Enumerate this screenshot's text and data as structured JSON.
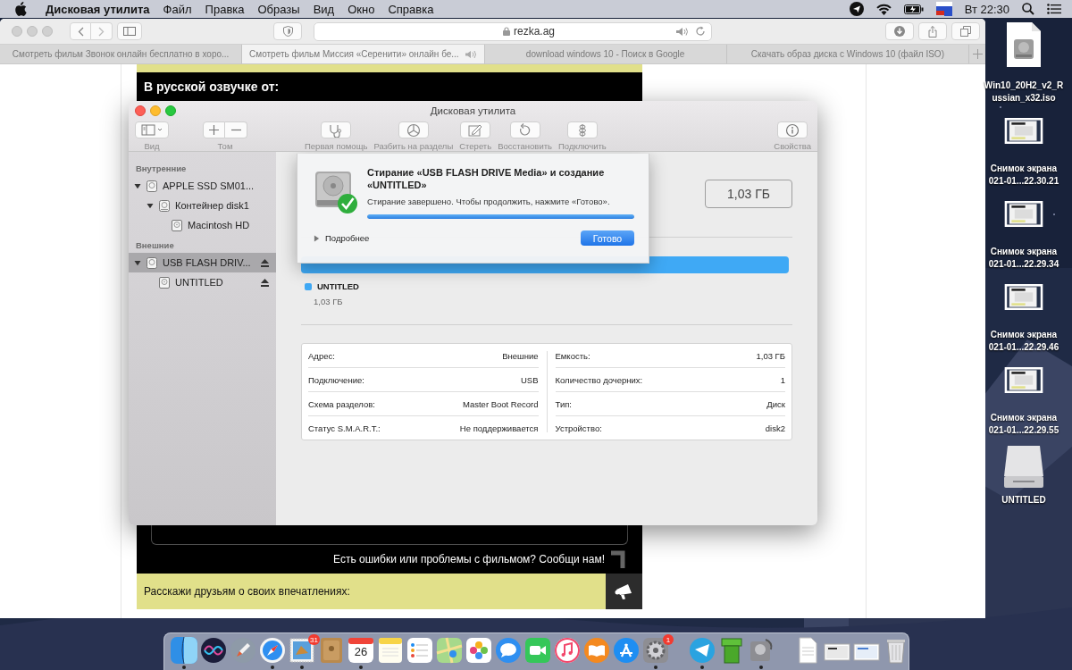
{
  "menubar": {
    "app_name": "Дисковая утилита",
    "menus": [
      "Файл",
      "Правка",
      "Образы",
      "Вид",
      "Окно",
      "Справка"
    ],
    "clock": "Вт 22:30"
  },
  "browser": {
    "url": "rezka.ag",
    "tabs": [
      {
        "label": "Смотреть фильм Звонок онлайн бесплатно в хоро...",
        "selected": false,
        "audio": false
      },
      {
        "label": "Смотреть фильм Миссия «Серенити» онлайн бе...",
        "selected": true,
        "audio": true
      },
      {
        "label": "download windows 10 - Поиск в Google",
        "selected": false,
        "audio": false
      },
      {
        "label": "Скачать образ диска с Windows 10 (файл ISO)",
        "selected": false,
        "audio": false
      }
    ],
    "page": {
      "heading": "В русской озвучке от:",
      "report_text": "Есть ошибки или проблемы с фильмом? Сообщи нам!",
      "share_text": "Расскажи друзьям о своих впечатлениях:"
    }
  },
  "disk_utility": {
    "title": "Дисковая утилита",
    "toolbar": [
      {
        "label": "Вид",
        "kind": "view"
      },
      {
        "label": "Том",
        "kind": "volume"
      },
      {
        "label": "Первая помощь",
        "kind": "first-aid"
      },
      {
        "label": "Разбить на разделы",
        "kind": "partition"
      },
      {
        "label": "Стереть",
        "kind": "erase"
      },
      {
        "label": "Восстановить",
        "kind": "restore"
      },
      {
        "label": "Подключить",
        "kind": "mount"
      },
      {
        "label": "Свойства",
        "kind": "info"
      }
    ],
    "sidebar": [
      {
        "title": "Внутренние",
        "items": [
          {
            "label": "APPLE SSD SM01...",
            "kind": "disk",
            "expanded": true,
            "selected": false,
            "children": [
              {
                "label": "Контейнер disk1",
                "kind": "container",
                "expanded": true,
                "selected": false,
                "children": [
                  {
                    "label": "Macintosh HD",
                    "kind": "volume",
                    "selected": false
                  }
                ]
              }
            ]
          }
        ]
      },
      {
        "title": "Внешние",
        "items": [
          {
            "label": "USB FLASH DRIV...",
            "kind": "disk",
            "expanded": true,
            "selected": true,
            "eject": true,
            "children": [
              {
                "label": "UNTITLED",
                "kind": "volume",
                "selected": false,
                "eject": true
              }
            ]
          }
        ]
      }
    ],
    "capacity": "1,03 ГБ",
    "partitions": [
      {
        "name": "UNTITLED",
        "size": "1,03 ГБ",
        "color": "#3fa9f5"
      }
    ],
    "info_left": [
      {
        "label": "Адрес:",
        "value": "Внешние"
      },
      {
        "label": "Подключение:",
        "value": "USB"
      },
      {
        "label": "Схема разделов:",
        "value": "Master Boot Record"
      },
      {
        "label": "Статус S.M.A.R.T.:",
        "value": "Не поддерживается"
      }
    ],
    "info_right": [
      {
        "label": "Емкость:",
        "value": "1,03 ГБ"
      },
      {
        "label": "Количество дочерних:",
        "value": "1"
      },
      {
        "label": "Тип:",
        "value": "Диск"
      },
      {
        "label": "Устройство:",
        "value": "disk2"
      }
    ],
    "sheet": {
      "title": "Стирание «USB FLASH DRIVE Media» и создание «UNTITLED»",
      "message": "Стирание завершено. Чтобы продолжить, нажмите «Готово».",
      "level": 1,
      "details": "Подробнее",
      "details_expanded": false,
      "button": "Готово"
    }
  },
  "desktop_icons": [
    {
      "kind": "disk-image",
      "label_lines": [
        "Win10_20H2_v2_R",
        "ussian_x32.iso"
      ]
    },
    {
      "kind": "screenshot",
      "label_lines": [
        "Снимок экрана",
        "021-01...22.30.21"
      ]
    },
    {
      "kind": "screenshot",
      "label_lines": [
        "Снимок экрана",
        "021-01...22.29.34"
      ]
    },
    {
      "kind": "screenshot",
      "label_lines": [
        "Снимок экрана",
        "021-01...22.29.46"
      ]
    },
    {
      "kind": "screenshot",
      "label_lines": [
        "Снимок экрана",
        "021-01...22.29.55"
      ]
    },
    {
      "kind": "drive",
      "label_lines": [
        "UNTITLED"
      ]
    }
  ],
  "dock": [
    {
      "kind": "finder",
      "running": true
    },
    {
      "kind": "siri"
    },
    {
      "kind": "launchpad"
    },
    {
      "kind": "safari",
      "running": true
    },
    {
      "kind": "mail",
      "running": true,
      "badge": "31"
    },
    {
      "kind": "contacts"
    },
    {
      "kind": "calendar",
      "running": true,
      "date": "26"
    },
    {
      "kind": "notes"
    },
    {
      "kind": "reminders"
    },
    {
      "kind": "maps"
    },
    {
      "kind": "photos"
    },
    {
      "kind": "messages"
    },
    {
      "kind": "facetime"
    },
    {
      "kind": "music"
    },
    {
      "kind": "books"
    },
    {
      "kind": "appstore"
    },
    {
      "kind": "settings",
      "running": true,
      "badge": "1"
    },
    {
      "kind": "separator"
    },
    {
      "kind": "telegram",
      "running": true
    },
    {
      "kind": "pipe"
    },
    {
      "kind": "diskutility",
      "running": true
    },
    {
      "kind": "separator"
    },
    {
      "kind": "document"
    },
    {
      "kind": "stack"
    },
    {
      "kind": "screenshot"
    },
    {
      "kind": "trash"
    }
  ]
}
